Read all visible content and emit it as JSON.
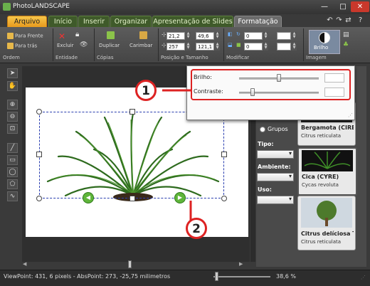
{
  "app": {
    "title": "PhotoLANDSCAPE"
  },
  "window_buttons": [
    "—",
    "□",
    "✕"
  ],
  "quick_icons": [
    "↶",
    "↷",
    "⇄",
    "?"
  ],
  "tabs": [
    "Arquivo",
    "Início",
    "Inserir",
    "Organizar",
    "Apresentação de Slides",
    "Formatação"
  ],
  "ribbon": {
    "ordem": {
      "label": "Ordem",
      "para_frente": "Para Frente",
      "para_tras": "Para trás"
    },
    "entidade": {
      "label": "Entidade",
      "excluir": "Excluir"
    },
    "copias": {
      "label": "Cópias",
      "duplicar": "Duplicar",
      "carimbar": "Carimbar"
    },
    "posicao": {
      "label": "Posição e Tamanho",
      "x": "21,2",
      "w": "49,6",
      "y": "257",
      "h": "121,1"
    },
    "modificar": {
      "label": "Modificar",
      "val1": "0",
      "val2": "0"
    },
    "imagem": {
      "label": "Imagem",
      "brilho": "Brilho"
    }
  },
  "popup": {
    "brilho_label": "Brilho:",
    "contraste_label": "Contraste:",
    "brilho_value": 0.5,
    "contraste_value": 0.17
  },
  "callouts": [
    "1",
    "2"
  ],
  "right_panel": {
    "grupos_label": "Grupos",
    "tipo_label": "Tipo:",
    "ambiente_label": "Ambiente:",
    "uso_label": "Uso:",
    "plants": [
      {
        "name": "Bergamota (CIRE",
        "species": "Citrus reticulata"
      },
      {
        "name": "Cica (CYRE)",
        "species": "Cycas revoluta"
      },
      {
        "name": "Citrus delíciosa T",
        "species": "Citrus reticulata"
      }
    ]
  },
  "status": {
    "text": "ViewPoint: 431, 6 pixels - AbsPoint: 273, -25,75 milimetros",
    "zoom": "38,6 %",
    "zoom_level": 0.02
  },
  "colors": {
    "accent_red": "#d22222",
    "tab_green": "#3f5a2a",
    "arquivo_orange": "#e79a1d"
  }
}
